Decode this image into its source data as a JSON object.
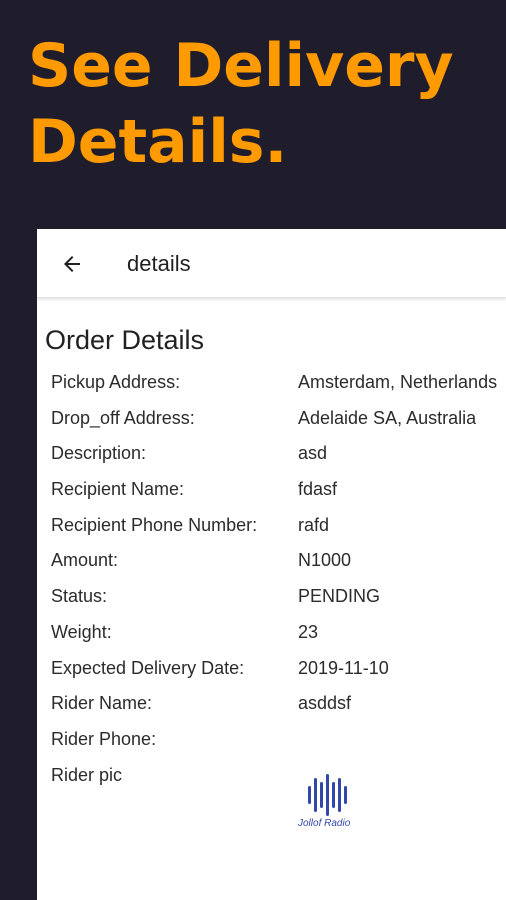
{
  "promo": {
    "line1": "See Delivery",
    "line2": "Details."
  },
  "app_bar": {
    "title": "details"
  },
  "section": {
    "title": "Order Details"
  },
  "details": [
    {
      "label": "Pickup Address:",
      "value": "Amsterdam, Netherlands"
    },
    {
      "label": "Drop_off Address:",
      "value": "Adelaide SA, Australia"
    },
    {
      "label": "Description:",
      "value": "asd"
    },
    {
      "label": "Recipient Name:",
      "value": "fdasf"
    },
    {
      "label": "Recipient Phone Number:",
      "value": "rafd"
    },
    {
      "label": "Amount:",
      "value": "N1000"
    },
    {
      "label": "Status:",
      "value": "PENDING"
    },
    {
      "label": "Weight:",
      "value": "23"
    },
    {
      "label": "Expected Delivery Date:",
      "value": "2019-11-10"
    },
    {
      "label": "Rider Name:",
      "value": "asddsf"
    },
    {
      "label": "Rider Phone:",
      "value": ""
    },
    {
      "label": "Rider pic",
      "value": ""
    }
  ],
  "rider_pic": {
    "logo_text": "Jollof Radio"
  },
  "colors": {
    "background": "#1f1d2b",
    "headline": "#ff9a00",
    "logo": "#3347a8"
  },
  "icons": {
    "back": "arrow-left-icon",
    "rider_pic": "jollof-radio-logo"
  }
}
